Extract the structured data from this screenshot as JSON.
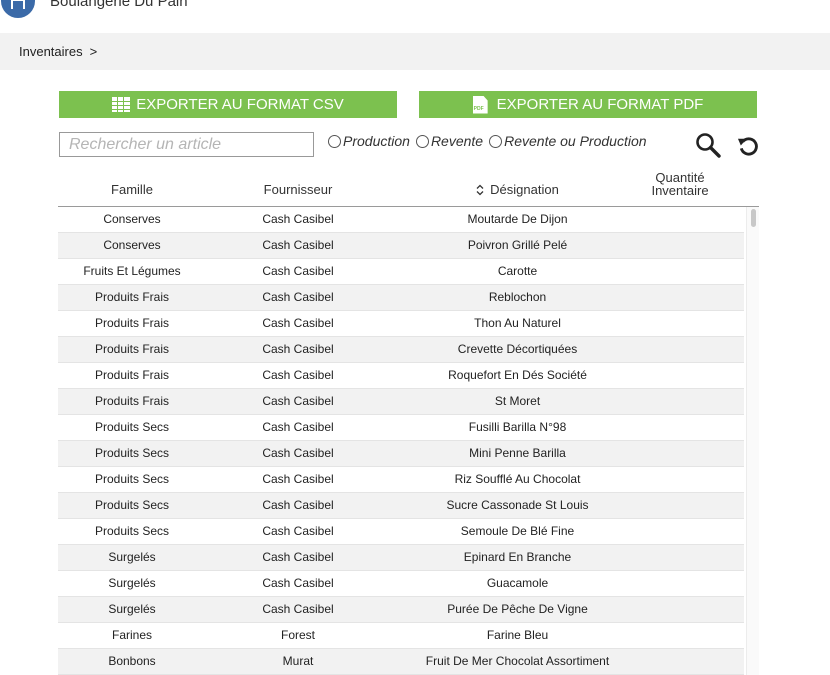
{
  "app": {
    "title": "Boulangerie Du Pain"
  },
  "breadcrumb": {
    "item": "Inventaires",
    "separator": ">"
  },
  "toolbar": {
    "export_csv_label": "EXPORTER AU FORMAT CSV",
    "export_pdf_label": "EXPORTER AU FORMAT PDF",
    "pdf_icon_text": "PDF",
    "accent_color": "#7cc14f"
  },
  "search": {
    "placeholder": "Rechercher un article",
    "value": ""
  },
  "filters": [
    {
      "label": "Production"
    },
    {
      "label": "Revente"
    },
    {
      "label": "Revente ou Production"
    }
  ],
  "icons": {
    "search": "search-icon",
    "refresh": "refresh-icon",
    "sort": "sort-icon"
  },
  "table": {
    "headers": {
      "famille": "Famille",
      "fournisseur": "Fournisseur",
      "designation": "Désignation",
      "quantite_1": "Quantité",
      "quantite_2": "Inventaire"
    },
    "rows": [
      {
        "famille": "Conserves",
        "fournisseur": "Cash Casibel",
        "designation": "Moutarde De Dijon",
        "quantite": ""
      },
      {
        "famille": "Conserves",
        "fournisseur": "Cash Casibel",
        "designation": "Poivron Grillé Pelé",
        "quantite": ""
      },
      {
        "famille": "Fruits Et Légumes",
        "fournisseur": "Cash Casibel",
        "designation": "Carotte",
        "quantite": ""
      },
      {
        "famille": "Produits Frais",
        "fournisseur": "Cash Casibel",
        "designation": "Reblochon",
        "quantite": ""
      },
      {
        "famille": "Produits Frais",
        "fournisseur": "Cash Casibel",
        "designation": "Thon Au Naturel",
        "quantite": ""
      },
      {
        "famille": "Produits Frais",
        "fournisseur": "Cash Casibel",
        "designation": "Crevette Décortiquées",
        "quantite": ""
      },
      {
        "famille": "Produits Frais",
        "fournisseur": "Cash Casibel",
        "designation": "Roquefort En Dés Société",
        "quantite": ""
      },
      {
        "famille": "Produits Frais",
        "fournisseur": "Cash Casibel",
        "designation": "St Moret",
        "quantite": ""
      },
      {
        "famille": "Produits Secs",
        "fournisseur": "Cash Casibel",
        "designation": "Fusilli Barilla N°98",
        "quantite": ""
      },
      {
        "famille": "Produits Secs",
        "fournisseur": "Cash Casibel",
        "designation": "Mini Penne Barilla",
        "quantite": ""
      },
      {
        "famille": "Produits Secs",
        "fournisseur": "Cash Casibel",
        "designation": "Riz Soufflé Au Chocolat",
        "quantite": ""
      },
      {
        "famille": "Produits Secs",
        "fournisseur": "Cash Casibel",
        "designation": "Sucre Cassonade St Louis",
        "quantite": ""
      },
      {
        "famille": "Produits Secs",
        "fournisseur": "Cash Casibel",
        "designation": "Semoule De Blé Fine",
        "quantite": ""
      },
      {
        "famille": "Surgelés",
        "fournisseur": "Cash Casibel",
        "designation": "Epinard En Branche",
        "quantite": ""
      },
      {
        "famille": "Surgelés",
        "fournisseur": "Cash Casibel",
        "designation": "Guacamole",
        "quantite": ""
      },
      {
        "famille": "Surgelés",
        "fournisseur": "Cash Casibel",
        "designation": "Purée De Pêche De Vigne",
        "quantite": ""
      },
      {
        "famille": "Farines",
        "fournisseur": "Forest",
        "designation": "Farine Bleu",
        "quantite": ""
      },
      {
        "famille": "Bonbons",
        "fournisseur": "Murat",
        "designation": "Fruit De Mer Chocolat Assortiment",
        "quantite": ""
      }
    ]
  }
}
